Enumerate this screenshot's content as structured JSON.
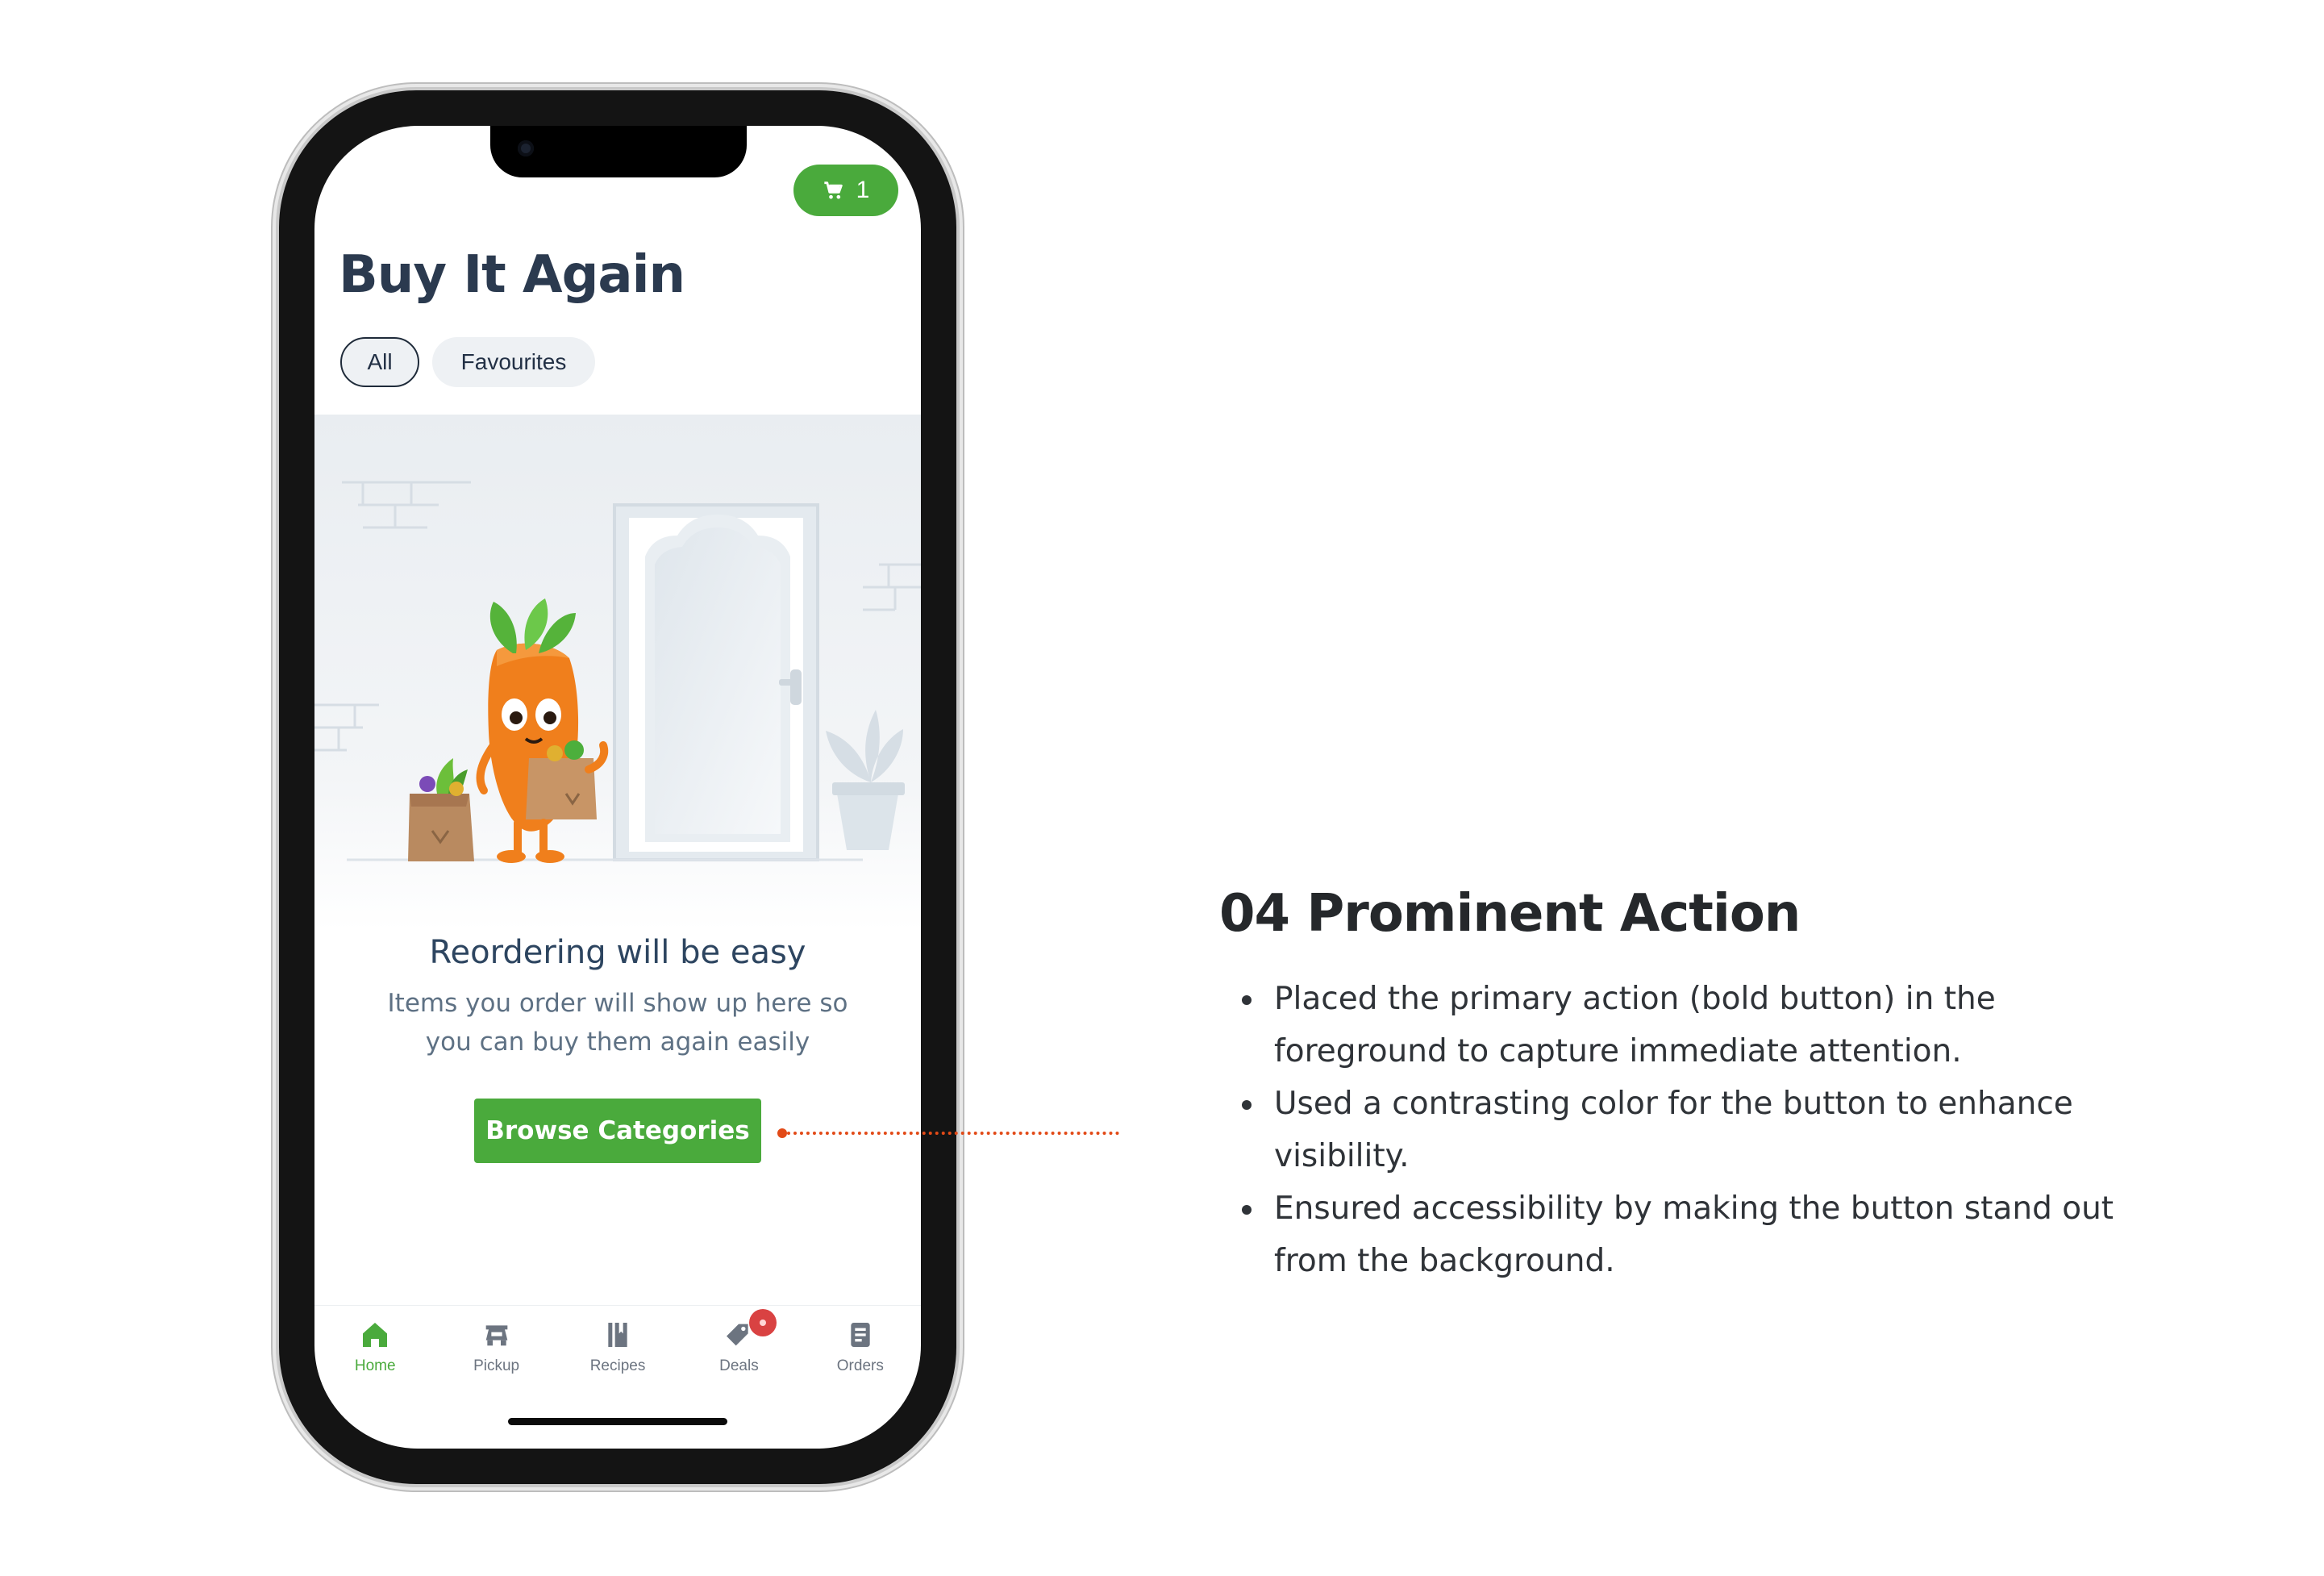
{
  "header": {
    "cart_count": "1",
    "title": "Buy It Again"
  },
  "filters": [
    {
      "label": "All",
      "selected": true
    },
    {
      "label": "Favourites",
      "selected": false
    }
  ],
  "empty_state": {
    "title": "Reordering will be easy",
    "body": "Items you order will show up here so you can buy them again easily",
    "button_label": "Browse Categories"
  },
  "tabbar": {
    "items": [
      {
        "label": "Home",
        "icon": "home-icon",
        "active": true
      },
      {
        "label": "Pickup",
        "icon": "pickup-icon",
        "active": false
      },
      {
        "label": "Recipes",
        "icon": "recipes-icon",
        "active": false
      },
      {
        "label": "Deals",
        "icon": "deals-icon",
        "active": false
      },
      {
        "label": "Orders",
        "icon": "orders-icon",
        "active": false
      }
    ]
  },
  "annotation": {
    "title": "04 Prominent Action",
    "points": [
      "Placed the primary action (bold button) in the foreground to capture immediate attention.",
      "Used a contrasting color for the button to enhance visibility.",
      "Ensured accessibility by making the button stand out from the background."
    ]
  },
  "colors": {
    "brand_green": "#4aaa3c",
    "connector_orange": "#e24a17",
    "title_navy": "#2b3a4f"
  }
}
